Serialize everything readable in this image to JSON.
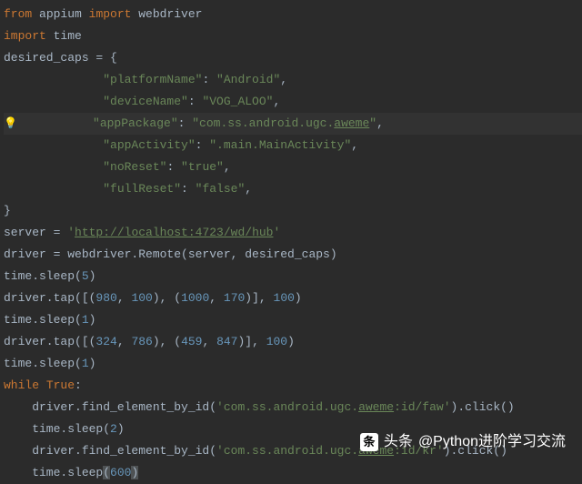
{
  "lines": {
    "l1_from": "from",
    "l1_mod": " appium ",
    "l1_import": "import",
    "l1_item": " webdriver",
    "l2_import": "import",
    "l2_item": " time",
    "l3": "desired_caps = {",
    "l4_key": "\"platformName\"",
    "l4_sep": ": ",
    "l4_val": "\"Android\"",
    "l5_key": "\"deviceName\"",
    "l5_sep": ": ",
    "l5_val": "\"VOG_ALOO\"",
    "l6_key": "\"appPackage\"",
    "l6_sep": ": ",
    "l6_val1": "\"com.ss.android.ugc.",
    "l6_val2": "aweme",
    "l6_val3": "\"",
    "l7_key": "\"appActivity\"",
    "l7_sep": ": ",
    "l7_val": "\".main.MainActivity\"",
    "l8_key": "\"noReset\"",
    "l8_sep": ": ",
    "l8_val": "\"true\"",
    "l9_key": "\"fullReset\"",
    "l9_sep": ": ",
    "l9_val": "\"false\"",
    "l10": "}",
    "l11a": "server = ",
    "l11b": "'",
    "l11c": "http://localhost:4723/wd/hub",
    "l11d": "'",
    "l12": "driver = webdriver.Remote(server, desired_caps)",
    "l13a": "time.sleep(",
    "l13b": "5",
    "l13c": ")",
    "l14a": "driver.tap([(",
    "l14b": "980",
    "l14c": ", ",
    "l14d": "100",
    "l14e": "), (",
    "l14f": "1000",
    "l14g": ", ",
    "l14h": "170",
    "l14i": ")], ",
    "l14j": "100",
    "l14k": ")",
    "l15a": "time.sleep(",
    "l15b": "1",
    "l15c": ")",
    "l16a": "driver.tap([(",
    "l16b": "324",
    "l16c": ", ",
    "l16d": "786",
    "l16e": "), (",
    "l16f": "459",
    "l16g": ", ",
    "l16h": "847",
    "l16i": ")], ",
    "l16j": "100",
    "l16k": ")",
    "l17a": "time.sleep(",
    "l17b": "1",
    "l17c": ")",
    "l18a": "while ",
    "l18b": "True",
    "l18c": ":",
    "l19a": "    driver.find_element_by_id(",
    "l19b": "'com.ss.android.ugc.",
    "l19c": "aweme",
    "l19d": ":id/faw'",
    "l19e": ").click()",
    "l20a": "    time.sleep(",
    "l20b": "2",
    "l20c": ")",
    "l21a": "    driver.find_element_by_id(",
    "l21b": "'com.ss.android.ugc.",
    "l21c": "aweme",
    "l21d": ":id/kr'",
    "l21e": ").click()",
    "l22a": "    time.sleep",
    "l22b": "(",
    "l22c": "600",
    "l22d": ")"
  },
  "watermark": {
    "icon": "头",
    "label": "头条",
    "text": "@Python进阶学习交流"
  },
  "indent": "              "
}
